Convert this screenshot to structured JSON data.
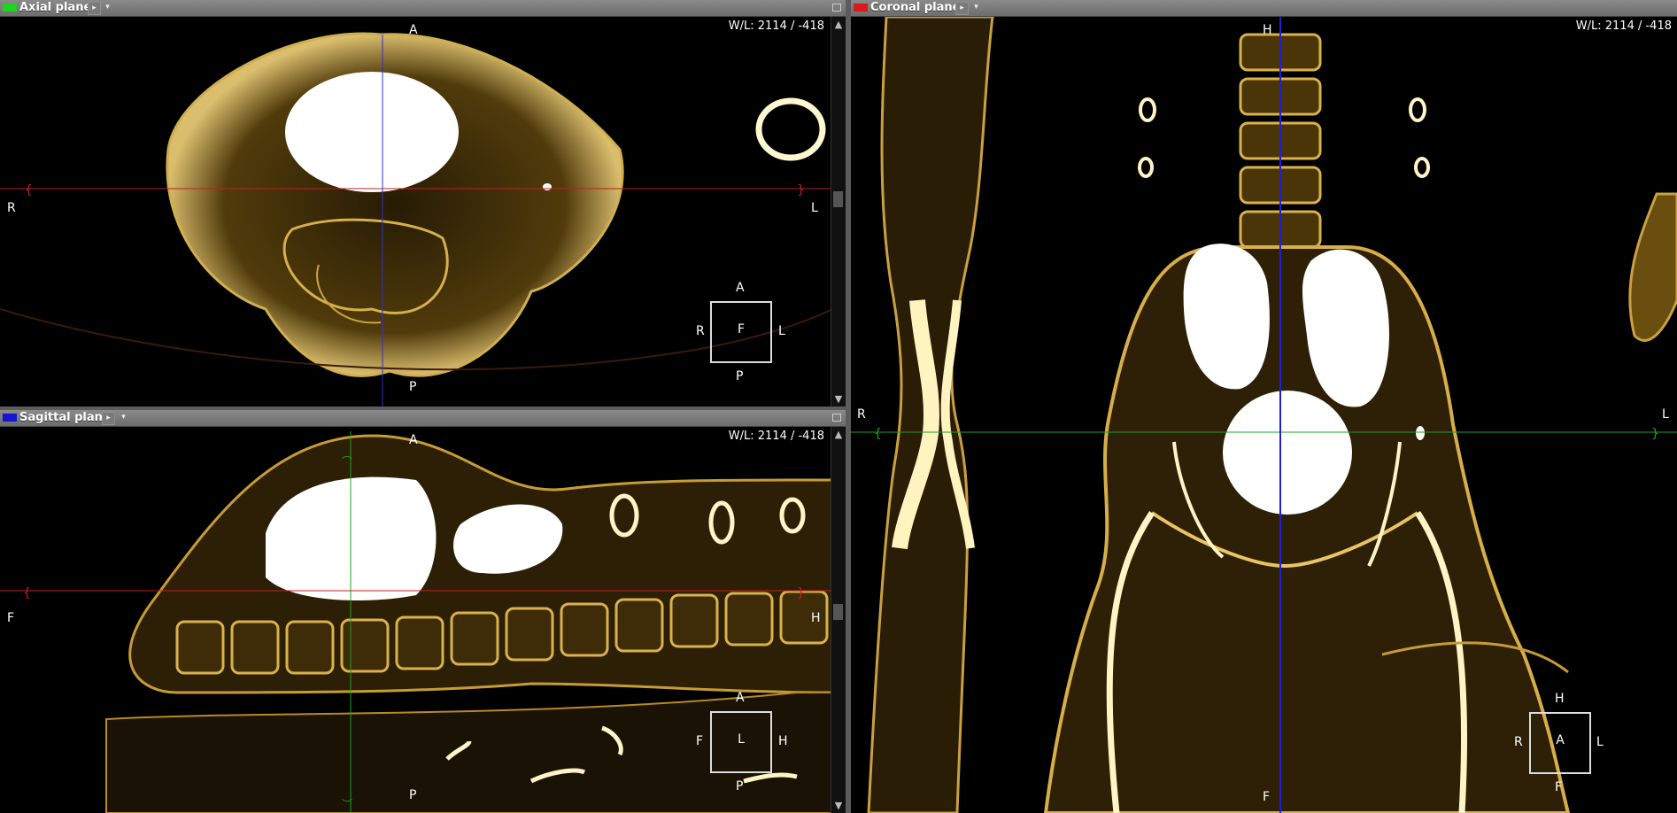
{
  "colors": {
    "axial": "#21d321",
    "sagittal": "#1515d0",
    "coronal": "#d81a1a",
    "tissue": "#b48a1e"
  },
  "axial": {
    "title": "Axial plane",
    "wl": "W/L: 2114 / -418",
    "top": "A",
    "bottom": "P",
    "left": "R",
    "right": "L",
    "cube": {
      "top": "A",
      "bottom": "P",
      "left": "R",
      "right": "L",
      "face": "F"
    }
  },
  "sagittal": {
    "title": "Sagittal plane",
    "wl": "W/L: 2114 / -418",
    "top": "A",
    "bottom": "P",
    "left": "F",
    "right": "H",
    "cube": {
      "top": "A",
      "bottom": "P",
      "left": "F",
      "right": "H",
      "face": "L"
    }
  },
  "coronal": {
    "title": "Coronal plane",
    "wl": "W/L: 2114 / -418",
    "top": "H",
    "bottom": "F",
    "left": "R",
    "right": "L",
    "cube": {
      "top": "H",
      "bottom": "F",
      "left": "R",
      "right": "L",
      "face": "A"
    }
  }
}
